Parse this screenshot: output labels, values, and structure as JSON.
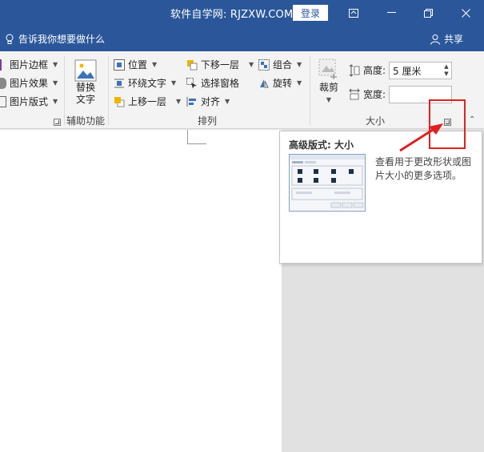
{
  "titlebar": {
    "text": "软件自学网: RJZXW.COM",
    "login_label": "登录"
  },
  "tellbar": {
    "tell_me": "告诉我你想要做什么",
    "share_label": "共享"
  },
  "ribbon": {
    "picture_styles": {
      "items": [
        "图片边框",
        "图片效果",
        "图片版式"
      ]
    },
    "accessibility": {
      "alt_text_line1": "替换",
      "alt_text_line2": "文字",
      "label": "辅助功能"
    },
    "arrange": {
      "position": "位置",
      "wrap_text": "环绕文字",
      "bring_forward": "上移一层",
      "send_backward": "下移一层",
      "selection_pane": "选择窗格",
      "align": "对齐",
      "group": "组合",
      "rotate": "旋转",
      "label": "排列"
    },
    "size": {
      "crop_label": "裁剪",
      "height_label": "高度:",
      "height_value": "5 厘米",
      "width_label": "宽度:",
      "width_value": "",
      "label": "大小"
    }
  },
  "tooltip": {
    "title": "高级版式: 大小",
    "description": "查看用于更改形状或图片大小的更多选项。"
  },
  "colors": {
    "titlebar": "#2b579a",
    "highlight": "#e02020"
  }
}
